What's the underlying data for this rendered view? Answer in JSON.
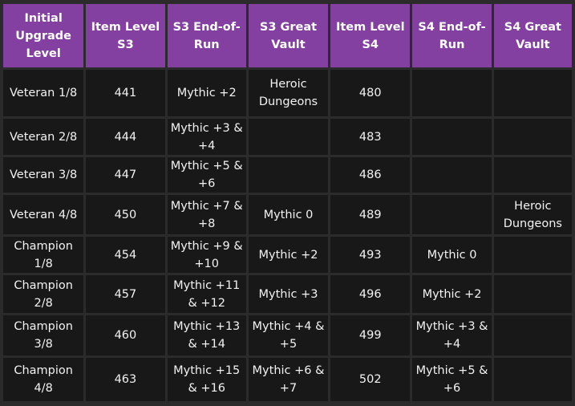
{
  "colors": {
    "header": "#8340a0",
    "cell": "#181818",
    "border": "#2b2b2b"
  },
  "headers": [
    "Initial Upgrade Level",
    "Item Level S3",
    "S3 End-of-Run",
    "S3 Great Vault",
    "Item Level S4",
    "S4 End-of-Run",
    "S4 Great Vault"
  ],
  "rows": [
    [
      "Veteran 1/8",
      "441",
      "Mythic +2",
      "Heroic Dungeons",
      "480",
      "",
      ""
    ],
    [
      "Veteran 2/8",
      "444",
      "Mythic +3 & +4",
      "",
      "483",
      "",
      ""
    ],
    [
      "Veteran 3/8",
      "447",
      "Mythic +5 & +6",
      "",
      "486",
      "",
      ""
    ],
    [
      "Veteran 4/8",
      "450",
      "Mythic +7 & +8",
      "Mythic 0",
      "489",
      "",
      "Heroic Dungeons"
    ],
    [
      "Champion 1/8",
      "454",
      "Mythic +9 & +10",
      "Mythic +2",
      "493",
      "Mythic 0",
      ""
    ],
    [
      "Champion 2/8",
      "457",
      "Mythic +11 & +12",
      "Mythic +3",
      "496",
      "Mythic +2",
      ""
    ],
    [
      "Champion 3/8",
      "460",
      "Mythic +13 & +14",
      "Mythic +4 & +5",
      "499",
      "Mythic +3 & +4",
      ""
    ],
    [
      "Champion 4/8",
      "463",
      "Mythic +15 & +16",
      "Mythic +6 & +7",
      "502",
      "Mythic +5 & +6",
      ""
    ]
  ]
}
